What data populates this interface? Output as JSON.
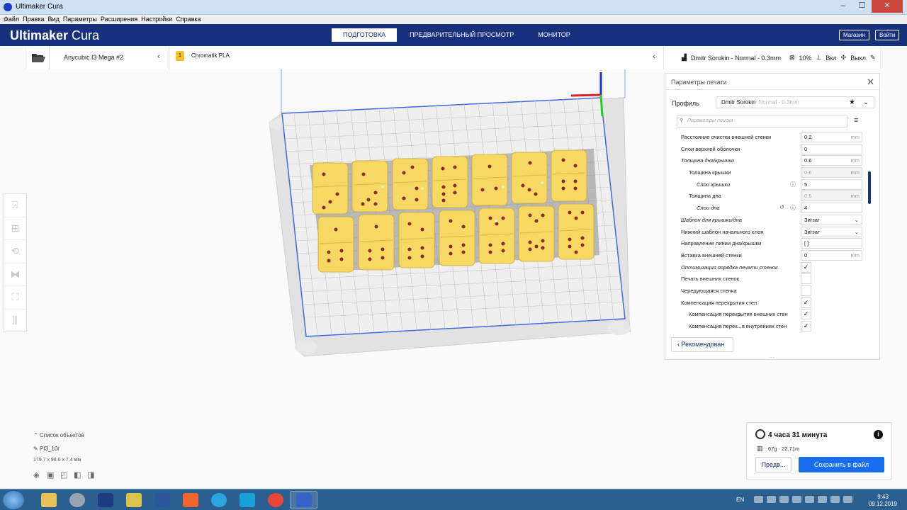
{
  "window": {
    "title": "Ultimaker Cura"
  },
  "menu": [
    "Файл",
    "Правка",
    "Вид",
    "Параметры",
    "Расширения",
    "Настройки",
    "Справка"
  ],
  "header": {
    "logo_bold": "Ultimaker",
    "logo_light": " Cura",
    "tabs": [
      "ПОДГОТОВКА",
      "ПРЕДВАРИТЕЛЬНЫЙ ПРОСМОТР",
      "МОНИТОР"
    ],
    "shop": "Магазин",
    "login": "Войти"
  },
  "stage": {
    "printer": "Anycubic I3 Mega #2",
    "material_index": "1",
    "material": "Chromatik PLA",
    "profile": "Dmitr Sorokin - Normal - 0.3mm",
    "infill": "10%",
    "support": "Вкл",
    "adhesion": "Выкл"
  },
  "panel": {
    "title": "Параметры печати",
    "profile_label": "Профиль",
    "profile_name": "Dmitr Sorokin",
    "profile_quality": "Normal - 0.3mm",
    "search_placeholder": "Параметры поиска",
    "recommended": "Рекомендован",
    "settings": [
      {
        "label": "Расстояние очистки внешней стенки",
        "value": "0.2",
        "unit": "mm",
        "type": "field"
      },
      {
        "label": "Слои верхней оболочки",
        "value": "0",
        "unit": "",
        "type": "field"
      },
      {
        "label": "Толщина дна/крышки",
        "value": "0.6",
        "unit": "mm",
        "type": "field",
        "italic": true
      },
      {
        "label": "Толщина крышки",
        "value": "0.6",
        "unit": "mm",
        "type": "field",
        "indent": 1,
        "disabled": true
      },
      {
        "label": "Слои крышки",
        "value": "5",
        "unit": "",
        "type": "field",
        "indent": 2,
        "italic": true,
        "info": true
      },
      {
        "label": "Толщина дна",
        "value": "0.6",
        "unit": "mm",
        "type": "field",
        "indent": 1,
        "disabled": true
      },
      {
        "label": "Слои дна",
        "value": "4",
        "unit": "",
        "type": "field",
        "indent": 2,
        "italic": true,
        "info": true,
        "reset": true
      },
      {
        "label": "Шаблон для крышки/дна",
        "value": "Зигзаг",
        "unit": "",
        "type": "select",
        "italic": true
      },
      {
        "label": "Нижний шаблон начального слоя",
        "value": "Зигзаг",
        "unit": "",
        "type": "select"
      },
      {
        "label": "Направление линии дна/крышки",
        "value": "[ ]",
        "unit": "",
        "type": "field"
      },
      {
        "label": "Вставка внешней стенки",
        "value": "0",
        "unit": "mm",
        "type": "field"
      },
      {
        "label": "Оптимизация порядка печати стенок",
        "checked": true,
        "type": "check",
        "italic": true
      },
      {
        "label": "Печать внешних стенок",
        "checked": false,
        "type": "check"
      },
      {
        "label": "Чередующаяся стенка",
        "checked": false,
        "type": "check"
      },
      {
        "label": "Компенсация перекрытия стен",
        "checked": true,
        "type": "check"
      },
      {
        "label": "Компенсация перекрытия внешних стен",
        "checked": true,
        "type": "check",
        "indent": 1
      },
      {
        "label": "Компенсация перек...я внутренних стен",
        "checked": true,
        "type": "check",
        "indent": 1
      }
    ]
  },
  "objects": {
    "list_label": "Список объектов",
    "name": "PI3_10г",
    "dimensions": "179.7 x 98.0 x 7.4 мм"
  },
  "estimate": {
    "time": "4 часа 31 минута",
    "material": "67g · 22.71m",
    "preview": "Предв...",
    "save": "Сохранить в файл"
  },
  "taskbar": {
    "lang": "EN",
    "time": "9:43",
    "date": "09.12.2019"
  },
  "colors": {
    "header": "#17317c",
    "accent": "#196ef0",
    "dice": "#f7d862",
    "pips": "#8b2a2a"
  }
}
